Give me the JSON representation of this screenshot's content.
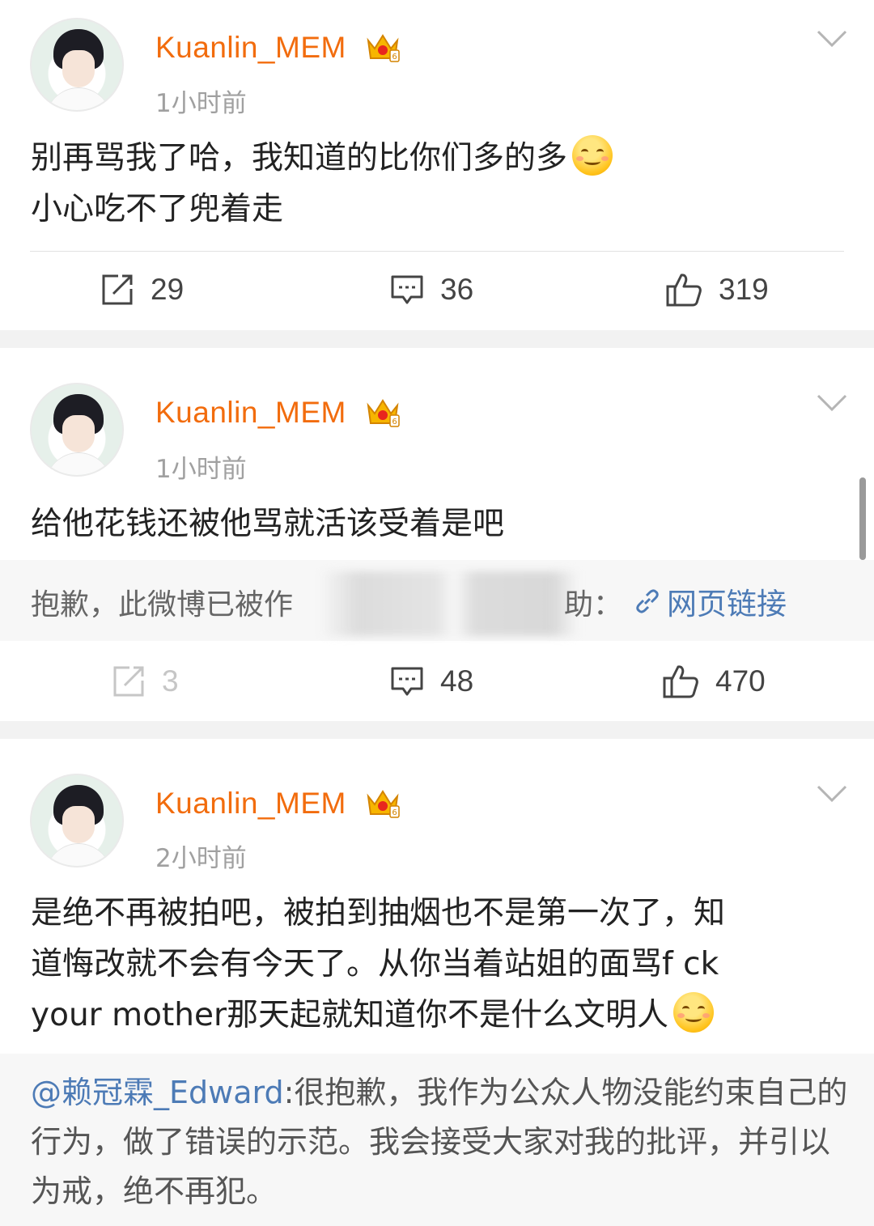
{
  "posts": [
    {
      "username": "Kuanlin_MEM",
      "time": "1小时前",
      "text_line1": "别再骂我了哈，我知道的比你们多的多",
      "text_line2": "小心吃不了兜着走",
      "repost_count": "29",
      "comment_count": "36",
      "like_count": "319"
    },
    {
      "username": "Kuanlin_MEM",
      "time": "1小时前",
      "text_line1": "给他花钱还被他骂就活该受着是吧",
      "notice_text": "抱歉，此微博已被作",
      "notice_tail": "助：",
      "notice_link": "网页链接",
      "repost_count": "3",
      "comment_count": "48",
      "like_count": "470"
    },
    {
      "username": "Kuanlin_MEM",
      "time": "2小时前",
      "text_line1": "是绝不再被拍吧，被拍到抽烟也不是第一次了，知",
      "text_line2": "道悔改就不会有今天了。从你当着站姐的面骂f ck",
      "text_line3": "your mother那天起就知道你不是什么文明人",
      "quote_mention": "@赖冠霖_Edward",
      "quote_text": ":很抱歉，我作为公众人物没能约束自己的行为，做了错误的示范。我会接受大家对我的批评，并引以为戒，绝不再犯。"
    }
  ],
  "icons": {
    "repost": "repost-icon",
    "comment": "comment-icon",
    "like": "like-icon",
    "menu": "chevron-down-icon",
    "vip": "crown-icon",
    "link": "link-icon"
  },
  "colors": {
    "username": "#f26c0d",
    "link": "#4d7bb6",
    "background": "#f2f2f2"
  }
}
